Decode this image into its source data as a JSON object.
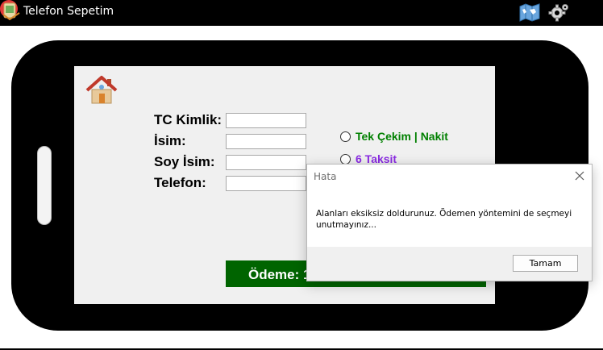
{
  "window": {
    "title": "Telefon Sepetim"
  },
  "form": {
    "fields": [
      {
        "label": "TC Kimlik:",
        "value": ""
      },
      {
        "label": "İsim:",
        "value": ""
      },
      {
        "label": "Soy İsim:",
        "value": ""
      },
      {
        "label": "Telefon:",
        "value": ""
      }
    ],
    "payment_options": [
      {
        "label": "Tek Çekim  |  Nakit",
        "color": "#008000",
        "selected": false
      },
      {
        "label": "6 Taksit",
        "color": "#8a2be2",
        "selected": false
      }
    ],
    "payment_bar": {
      "label": "Ödeme: 1",
      "color": "#006400"
    }
  },
  "dialog": {
    "title": "Hata",
    "message": "Alanları eksiksiz doldurunuz. Ödemen yöntemini de seçmeyi unutmayınız...",
    "ok_label": "Tamam"
  },
  "colors": {
    "titlebar": "#000000",
    "phone_body": "#000000",
    "screen": "#f0f0f0",
    "close_button": "#e53b3b",
    "phone_dot": "#1e8a34"
  },
  "icons": {
    "app": "phone-cart-icon",
    "map": "world-map-icon",
    "settings": "gear-icon",
    "close": "close-icon",
    "home": "home-icon"
  }
}
